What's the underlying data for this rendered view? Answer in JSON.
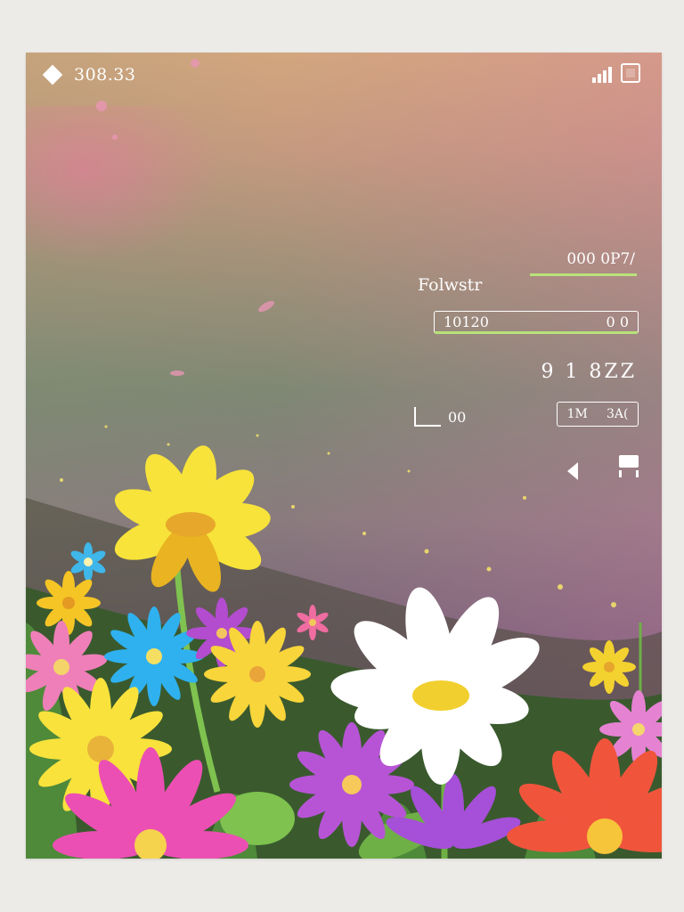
{
  "status_bar": {
    "time": "308.33",
    "icons": [
      "diamond-icon",
      "signal-icon",
      "battery-icon"
    ]
  },
  "overlay": {
    "readout_top": "000 0P7/",
    "label_primary": "Folwstr",
    "field_left": "10120",
    "field_right": "0 0",
    "readout_mid": "9 1 8ZZ",
    "label_secondary": "00",
    "button_left": "1M",
    "button_right": "3A(",
    "icons": [
      "sound-icon",
      "mic-icon"
    ]
  },
  "colors": {
    "accent": "#b8e27a",
    "ui_foreground": "#ffffff"
  }
}
